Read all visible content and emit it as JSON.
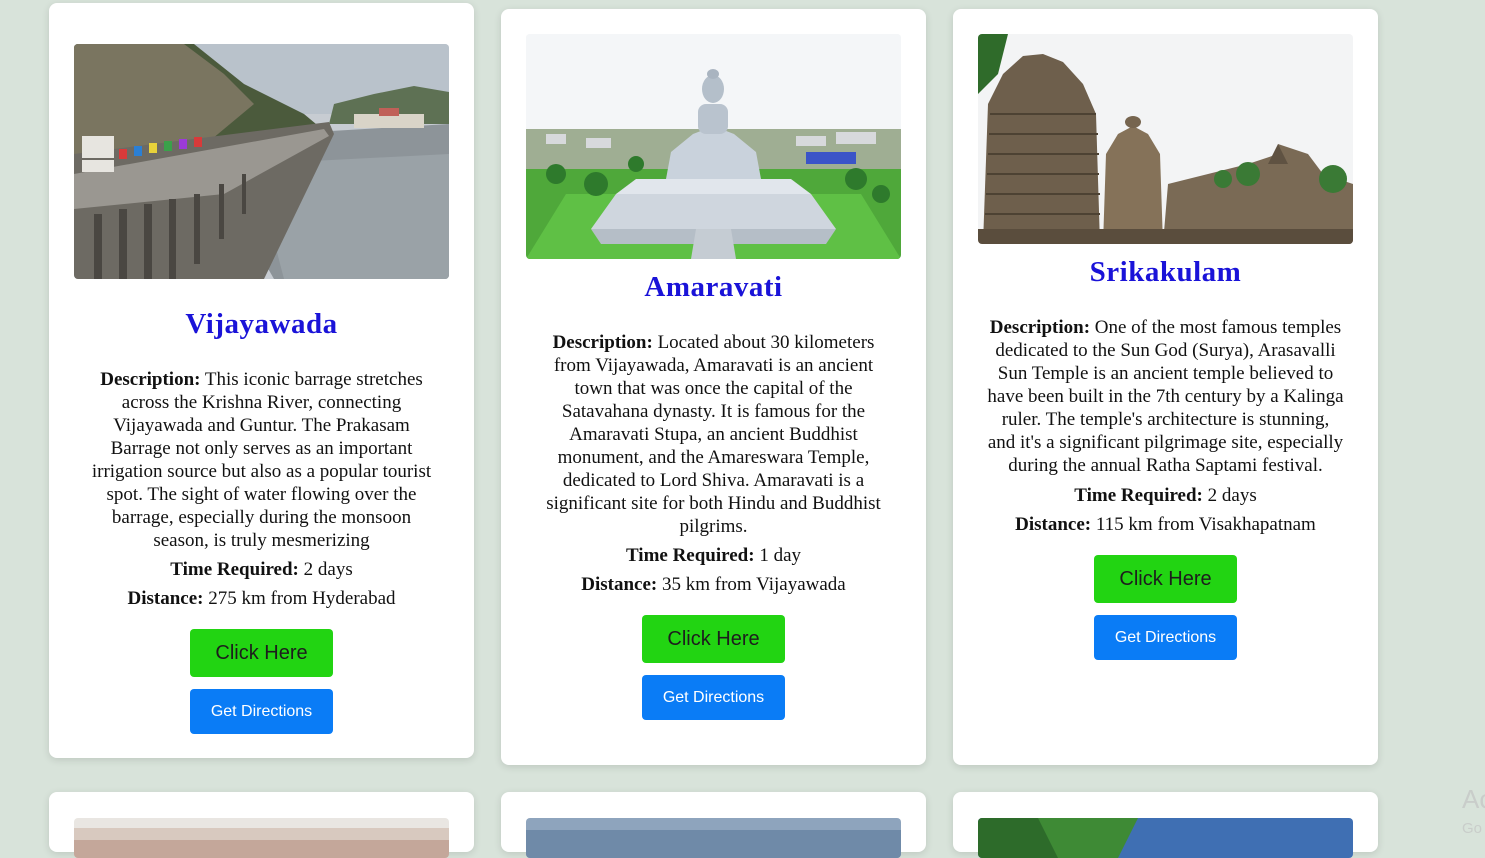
{
  "cards": [
    {
      "title": "Vijayawada",
      "image_alt": "Prakasam Barrage over the Krishna River",
      "description_label": "Description:",
      "description": " This iconic barrage stretches across the Krishna River, connecting Vijayawada and Guntur. The Prakasam Barrage not only serves as an important irrigation source but also as a popular tourist spot. The sight of water flowing over the barrage, especially during the monsoon season, is truly mesmerizing",
      "time_label": "Time Required:",
      "time": " 2 days",
      "distance_label": "Distance:",
      "distance": " 275 km from Hyderabad",
      "click_label": "Click Here",
      "directions_label": "Get Directions"
    },
    {
      "title": "Amaravati",
      "image_alt": "Dhyana Buddha statue at Amaravati",
      "description_label": "Description:",
      "description": " Located about 30 kilometers from Vijayawada, Amaravati is an ancient town that was once the capital of the Satavahana dynasty. It is famous for the Amaravati Stupa, an ancient Buddhist monument, and the Amareswara Temple, dedicated to Lord Shiva. Amaravati is a significant site for both Hindu and Buddhist pilgrims.",
      "time_label": "Time Required:",
      "time": " 1 day",
      "distance_label": "Distance:",
      "distance": " 35 km from Vijayawada",
      "click_label": "Click Here",
      "directions_label": "Get Directions"
    },
    {
      "title": "Srikakulam",
      "image_alt": "Arasavalli Sun Temple",
      "description_label": "Description:",
      "description": " One of the most famous temples dedicated to the Sun God (Surya), Arasavalli Sun Temple is an ancient temple believed to have been built in the 7th century by a Kalinga ruler. The temple's architecture is stunning, and it's a significant pilgrimage site, especially during the annual Ratha Saptami festival.",
      "time_label": "Time Required:",
      "time": " 2 days",
      "distance_label": "Distance:",
      "distance": " 115 km from Visakhapatnam",
      "click_label": "Click Here",
      "directions_label": "Get Directions"
    }
  ],
  "watermark": {
    "line1": "Ac",
    "line2": "Go"
  }
}
